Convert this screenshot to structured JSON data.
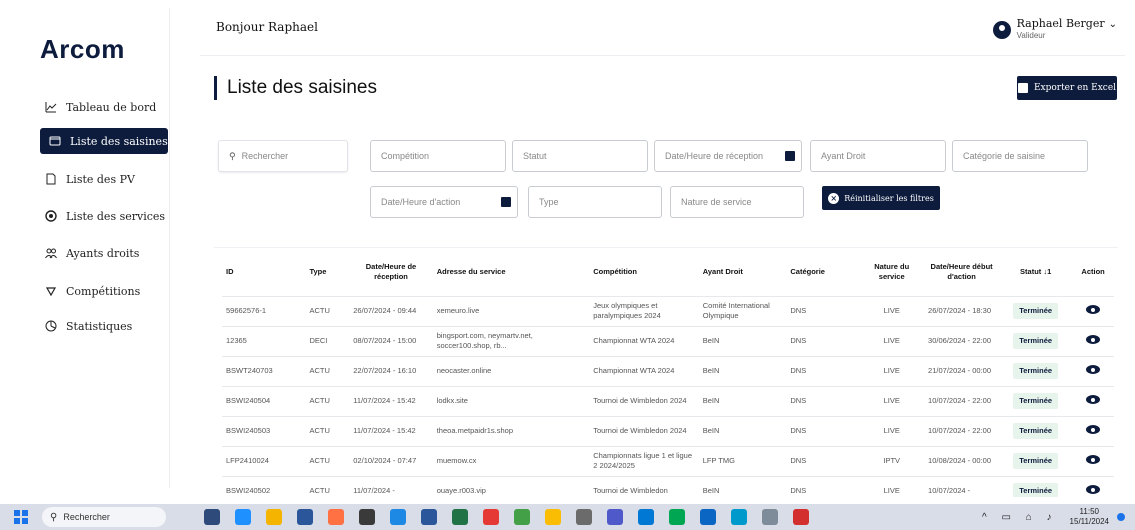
{
  "app": {
    "logo": "Arcom"
  },
  "sidebar": {
    "items": [
      {
        "label": "Tableau de bord",
        "icon": "chart-line-icon",
        "active": false
      },
      {
        "label": "Liste des saisines",
        "icon": "folder-icon",
        "active": true
      },
      {
        "label": "Liste des PV",
        "icon": "document-icon",
        "active": false
      },
      {
        "label": "Liste des services",
        "icon": "target-icon",
        "active": false
      },
      {
        "label": "Ayants droits",
        "icon": "users-icon",
        "active": false
      },
      {
        "label": "Compétitions",
        "icon": "trophy-icon",
        "active": false
      },
      {
        "label": "Statistiques",
        "icon": "stats-icon",
        "active": false
      }
    ]
  },
  "header": {
    "greeting": "Bonjour Raphael",
    "user_name": "Raphael Berger",
    "user_role": "Valideur"
  },
  "page": {
    "title": "Liste des saisines",
    "export_label": "Exporter en Excel"
  },
  "filters": {
    "search_placeholder": "Rechercher",
    "competition": "Compétition",
    "statut": "Statut",
    "date_reception": "Date/Heure de réception",
    "ayant_droit": "Ayant Droit",
    "categorie": "Catégorie de saisine",
    "date_action": "Date/Heure d'action",
    "type": "Type",
    "nature_service": "Nature de service",
    "reset_label": "Réinitialiser les filtres"
  },
  "table": {
    "headers": {
      "id": "ID",
      "type": "Type",
      "date_reception": "Date/Heure de réception",
      "adresse": "Adresse du service",
      "competition": "Compétition",
      "ayant_droit": "Ayant Droit",
      "categorie": "Catégorie",
      "nature": "Nature du service",
      "date_action": "Date/Heure début d'action",
      "statut": "Statut ↓1",
      "action": "Action"
    },
    "rows": [
      {
        "id": "59662576-1",
        "type": "ACTU",
        "date_reception": "26/07/2024 - 09:44",
        "adresse": "xemeuro.live",
        "competition": "Jeux olympiques et paralympiques 2024",
        "ayant_droit": "Comité International Olympique",
        "categorie": "DNS",
        "nature": "LIVE",
        "date_action": "26/07/2024 - 18:30",
        "statut": "Terminée"
      },
      {
        "id": "12365",
        "type": "DECI",
        "date_reception": "08/07/2024 - 15:00",
        "adresse": "bingsport.com, neymartv.net, soccer100.shop, rb...",
        "competition": "Championnat WTA 2024",
        "ayant_droit": "BeIN",
        "categorie": "DNS",
        "nature": "LIVE",
        "date_action": "30/06/2024 - 22:00",
        "statut": "Terminée"
      },
      {
        "id": "BSWT240703",
        "type": "ACTU",
        "date_reception": "22/07/2024 - 16:10",
        "adresse": "neocaster.online",
        "competition": "Championnat WTA 2024",
        "ayant_droit": "BeIN",
        "categorie": "DNS",
        "nature": "LIVE",
        "date_action": "21/07/2024 - 00:00",
        "statut": "Terminée"
      },
      {
        "id": "BSWI240504",
        "type": "ACTU",
        "date_reception": "11/07/2024 - 15:42",
        "adresse": "lodkx.site",
        "competition": "Tournoi de Wimbledon 2024",
        "ayant_droit": "BeIN",
        "categorie": "DNS",
        "nature": "LIVE",
        "date_action": "10/07/2024 - 22:00",
        "statut": "Terminée"
      },
      {
        "id": "BSWI240503",
        "type": "ACTU",
        "date_reception": "11/07/2024 - 15:42",
        "adresse": "theoa.metpaidr1s.shop",
        "competition": "Tournoi de Wimbledon 2024",
        "ayant_droit": "BeIN",
        "categorie": "DNS",
        "nature": "LIVE",
        "date_action": "10/07/2024 - 22:00",
        "statut": "Terminée"
      },
      {
        "id": "LFP2410024",
        "type": "ACTU",
        "date_reception": "02/10/2024 - 07:47",
        "adresse": "muemow.cx",
        "competition": "Championnats ligue 1 et ligue 2 2024/2025",
        "ayant_droit": "LFP TMG",
        "categorie": "DNS",
        "nature": "IPTV",
        "date_action": "10/08/2024 - 00:00",
        "statut": "Terminée"
      },
      {
        "id": "BSWI240502",
        "type": "ACTU",
        "date_reception": "11/07/2024 -",
        "adresse": "ouaye.r003.vip",
        "competition": "Tournoi de Wimbledon",
        "ayant_droit": "BeIN",
        "categorie": "DNS",
        "nature": "LIVE",
        "date_action": "10/07/2024 -",
        "statut": "Terminée"
      }
    ]
  },
  "taskbar": {
    "search_label": "Rechercher",
    "time": "11:50",
    "date": "15/11/2024"
  }
}
